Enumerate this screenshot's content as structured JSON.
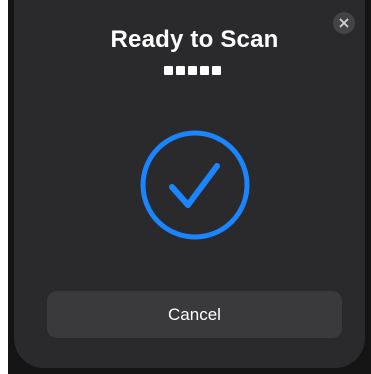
{
  "dialog": {
    "title": "Ready to Scan",
    "code_dots": [
      1,
      2,
      3,
      4,
      5
    ],
    "status_icon": "checkmark-circle-icon",
    "close_icon": "close-icon",
    "cancel_label": "Cancel"
  },
  "colors": {
    "sheet_background": "#2a2a2c",
    "accent": "#1a85ff",
    "button_background": "#3a3a3d",
    "text": "#ffffff"
  }
}
